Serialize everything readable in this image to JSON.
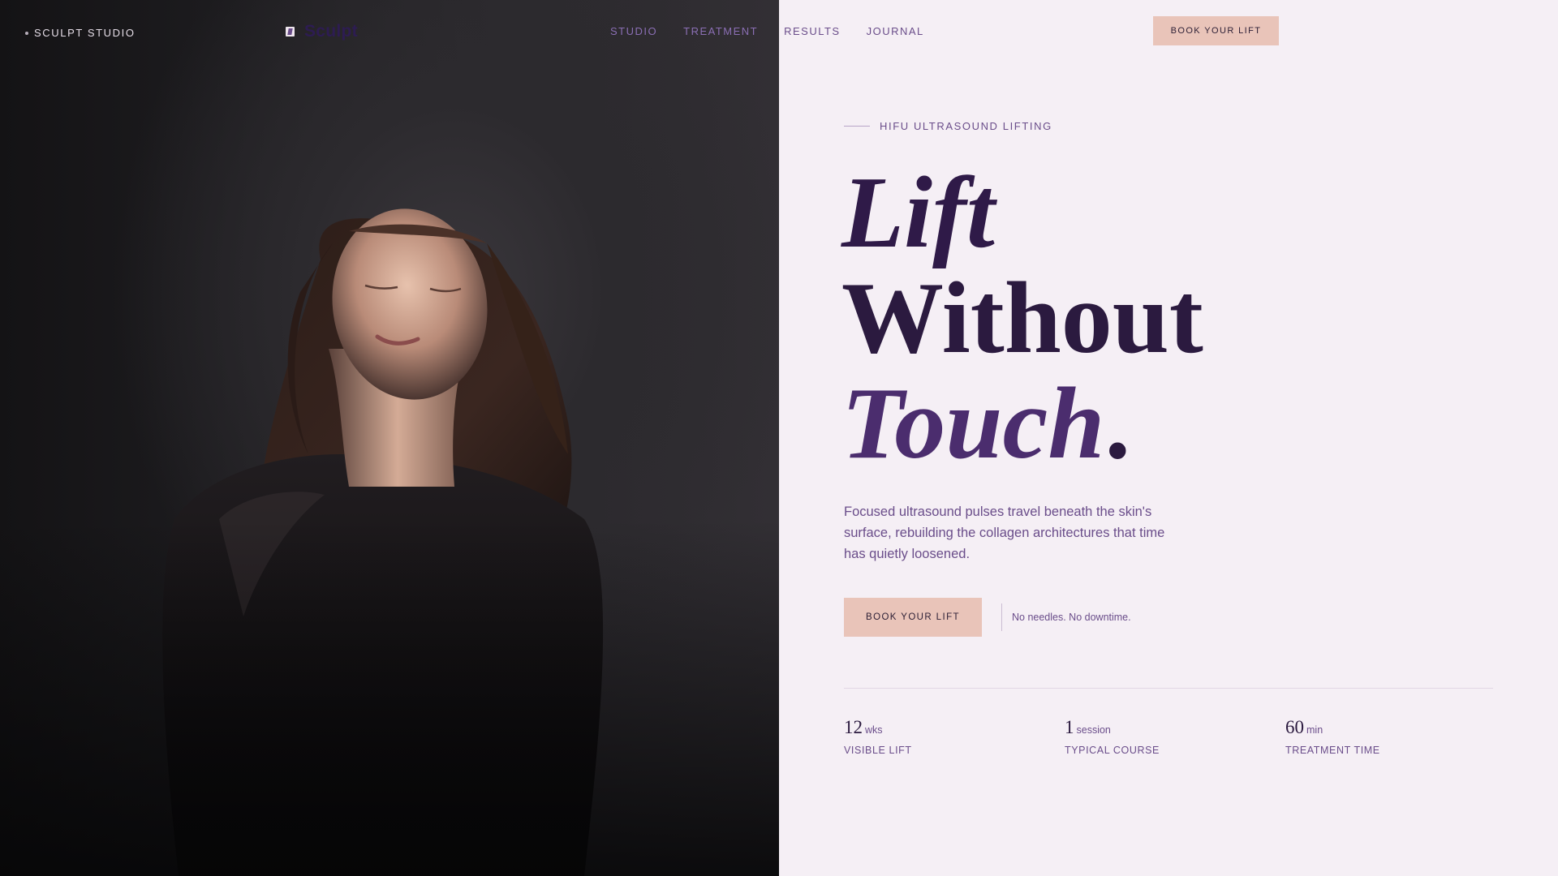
{
  "brand": {
    "studio_name": "SCULPT STUDIO",
    "logo_name": "Sculpt"
  },
  "nav": {
    "items": [
      {
        "label": "STUDIO"
      },
      {
        "label": "TREATMENT"
      },
      {
        "label": "RESULTS"
      },
      {
        "label": "JOURNAL"
      }
    ],
    "cta_label": "BOOK YOUR LIFT"
  },
  "hero": {
    "eyebrow": "HIFU ULTRASOUND LIFTING",
    "headline": {
      "line1": "Lift",
      "line2": "Without",
      "line3": "Touch",
      "line3_punct": "."
    },
    "lead": "Focused ultrasound pulses travel beneath the skin's surface, rebuilding the collagen architectures that time has quietly loosened.",
    "cta_label": "BOOK YOUR LIFT",
    "cta_note": "No needles. No downtime."
  },
  "stats": [
    {
      "value": "12",
      "unit": "wks",
      "label": "VISIBLE LIFT"
    },
    {
      "value": "1",
      "unit": "session",
      "label": "TYPICAL COURSE"
    },
    {
      "value": "60",
      "unit": "min",
      "label": "TREATMENT TIME"
    }
  ],
  "colors": {
    "accent_peach": "#e9c4b9",
    "text_deep_plum": "#2b1a3f",
    "text_violet": "#6a4d8a",
    "panel_background": "#f5eff5",
    "photo_dark": "#2a282c"
  }
}
